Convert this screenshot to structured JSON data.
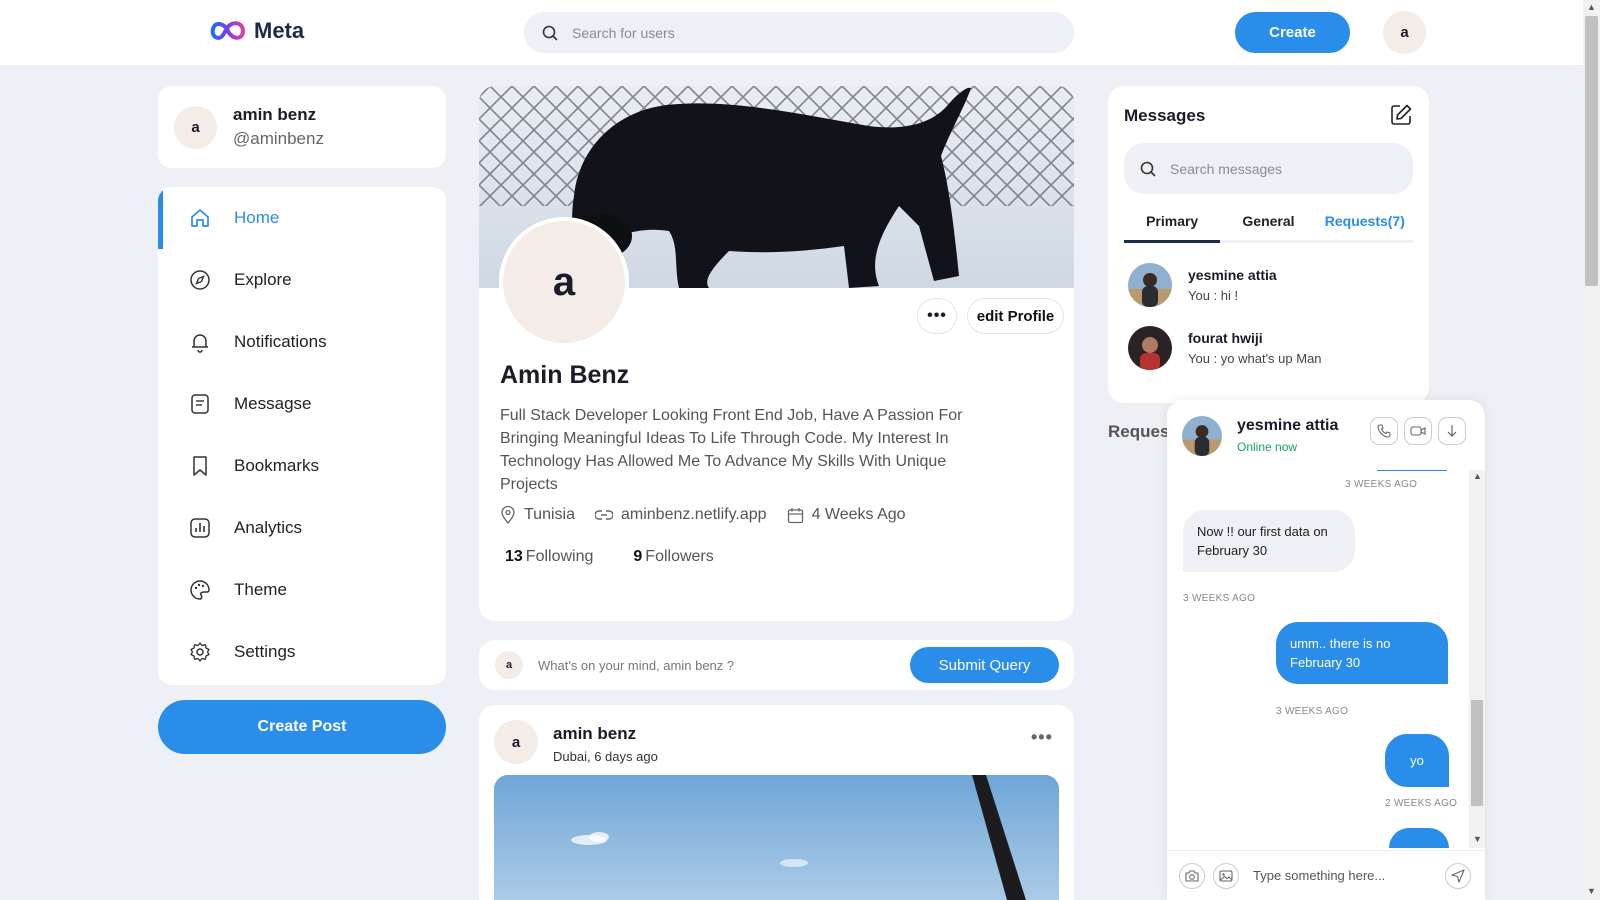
{
  "nav": {
    "logo_text": "Meta",
    "search_placeholder": "Search for users",
    "create_label": "Create",
    "avatar_letter": "a"
  },
  "profile_card": {
    "avatar_letter": "a",
    "name": "amin benz",
    "handle": "@aminbenz"
  },
  "sidebar": {
    "items": [
      {
        "label": "Home",
        "icon": "home-icon",
        "active": true
      },
      {
        "label": "Explore",
        "icon": "compass-icon"
      },
      {
        "label": "Notifications",
        "icon": "bell-icon"
      },
      {
        "label": "Messagse",
        "icon": "message-icon"
      },
      {
        "label": "Bookmarks",
        "icon": "bookmark-icon"
      },
      {
        "label": "Analytics",
        "icon": "analytics-icon"
      },
      {
        "label": "Theme",
        "icon": "palette-icon"
      },
      {
        "label": "Settings",
        "icon": "gear-icon"
      }
    ],
    "create_post_label": "Create Post"
  },
  "profile": {
    "avatar_letter": "a",
    "dots": "•••",
    "edit_label": "edit Profile",
    "name": "Amin Benz",
    "bio": "Full Stack Developer Looking Front End Job, Have A Passion For Bringing Meaningful Ideas To Life Through Code. My Interest In Technology Has Allowed Me To Advance My Skills With Unique Projects",
    "location": "Tunisia",
    "website": "aminbenz.netlify.app",
    "joined": "4 Weeks Ago",
    "following_count": "13",
    "following_label": "Following",
    "followers_count": "9",
    "followers_label": "Followers"
  },
  "composer": {
    "avatar_letter": "a",
    "placeholder": "What's on your mind, amin benz ?",
    "submit_label": "Submit Query"
  },
  "post": {
    "avatar_letter": "a",
    "author": "amin benz",
    "location_time": "Dubai, 6 days ago",
    "dots": "•••"
  },
  "messages": {
    "title": "Messages",
    "search_placeholder": "Search messages",
    "tabs": [
      "Primary",
      "General",
      "Requests(7)"
    ],
    "conversations": [
      {
        "name": "yesmine attia",
        "last": "You : hi !"
      },
      {
        "name": "fourat hwiji",
        "last": "You : yo what's up Man"
      }
    ],
    "requests_label": "Reques"
  },
  "chat": {
    "name": "yesmine attia",
    "status": "Online now",
    "items": [
      {
        "kind": "time",
        "text": "3 WEEKS AGO"
      },
      {
        "kind": "in",
        "text": "Now !! our first data on February 30"
      },
      {
        "kind": "time",
        "text": "3 WEEKS AGO"
      },
      {
        "kind": "out",
        "text": "umm.. there is no February 30"
      },
      {
        "kind": "time",
        "text": "3 WEEKS AGO"
      },
      {
        "kind": "out",
        "text": "yo"
      },
      {
        "kind": "time",
        "text": "2 WEEKS AGO"
      }
    ],
    "input_placeholder": "Type something here..."
  },
  "colors": {
    "accent": "#2a8de9",
    "background": "#eef0f6",
    "online": "#1aa260"
  }
}
